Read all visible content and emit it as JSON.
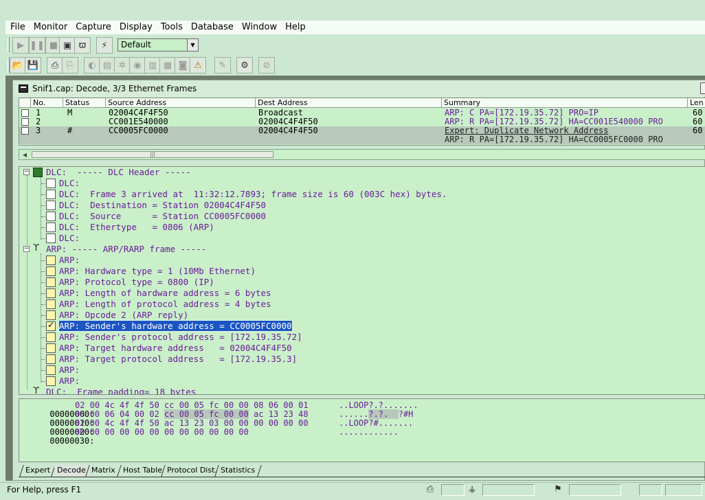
{
  "menu": [
    "File",
    "Monitor",
    "Capture",
    "Display",
    "Tools",
    "Database",
    "Window",
    "Help"
  ],
  "toolbar": {
    "profile_value": "Default",
    "row1_icons": [
      "play-icon",
      "pause-icon",
      "stop-icon",
      "stop-and-display-icon",
      "binoculars-icon",
      "define-filter-icon"
    ],
    "row2_icons": [
      "open-icon",
      "save-icon",
      "print-icon",
      "print-preview-icon",
      "dashboard-icon",
      "host-table-icon",
      "matrix-icon",
      "history-icon",
      "protocol-distribution-icon",
      "global-statistics-icon",
      "alarm-log-icon",
      "alarm-icon",
      "address-book-icon",
      "options-icon",
      "disable-icon"
    ]
  },
  "capture_window": {
    "title": "Snif1.cap: Decode, 3/3 Ethernet Frames"
  },
  "summary_table": {
    "columns": [
      "No.",
      "Status",
      "Source Address",
      "Dest Address",
      "Summary",
      "Len"
    ],
    "rows": [
      {
        "no": "1",
        "status": "M",
        "source": "02004C4F4F50",
        "dest": "Broadcast",
        "summary": "ARP: C PA=[172.19.35.72] PRO=IP",
        "len": "60"
      },
      {
        "no": "2",
        "status": "",
        "source": "CC001E540000",
        "dest": "02004C4F4F50",
        "summary": "ARP: R PA=[172.19.35.72] HA=CC001E540000 PRO",
        "len": "60"
      },
      {
        "no": "3",
        "status": "#",
        "source": "CC0005FC0000",
        "dest": "02004C4F4F50",
        "summary": "Expert: Duplicate Network Address",
        "summary2": "ARP: R PA=[172.19.35.72] HA=CC0005FC0000 PRO",
        "len": "60"
      }
    ]
  },
  "decode_tree": {
    "dlc_header": "DLC:  ----- DLC Header -----",
    "dlc_lines": [
      "DLC:",
      "DLC:  Frame 3 arrived at  11:32:12.7893; frame size is 60 (003C hex) bytes.",
      "DLC:  Destination = Station 02004C4F4F50",
      "DLC:  Source      = Station CC0005FC0000",
      "DLC:  Ethertype   = 0806 (ARP)",
      "DLC:"
    ],
    "arp_header": "ARP: ----- ARP/RARP frame -----",
    "arp_lines": [
      "ARP:",
      "ARP: Hardware type = 1 (10Mb Ethernet)",
      "ARP: Protocol type = 0800 (IP)",
      "ARP: Length of hardware address = 6 bytes",
      "ARP: Length of protocol address = 4 bytes",
      "ARP: Opcode 2 (ARP reply)",
      "ARP: Sender's hardware address = CC0005FC0000",
      "ARP: Sender's protocol address = [172.19.35.72]",
      "ARP: Target hardware address   = 02004C4F4F50",
      "ARP: Target protocol address   = [172.19.35.3]",
      "ARP:",
      "ARP:"
    ],
    "padding_line": "DLC:  Frame padding= 18 bytes"
  },
  "hex_dump": [
    {
      "addr": "00000000:",
      "bytes_a": "02 00 4c 4f 4f 50 cc 00 05 fc 00 00 08 06 00 01",
      "ascii": "..LOOP?.?......."
    },
    {
      "addr": "00000010:",
      "bytes_a": "08 00 06 04 00 02 ",
      "bytes_hl": "cc 00 05 fc 00 00",
      "bytes_b": " ac 13 23 48",
      "ascii_a": "......",
      "ascii_hl": "?.?.  ",
      "ascii_b": "?#H"
    },
    {
      "addr": "00000020:",
      "bytes_a": "02 00 4c 4f 4f 50 ac 13 23 03 00 00 00 00 00 00",
      "ascii": "..LOOP?#......."
    },
    {
      "addr": "00000030:",
      "bytes_a": "00 00 00 00 00 00 00 00 00 00 00 00",
      "ascii": "............"
    }
  ],
  "tabs": [
    "Expert",
    "Decode",
    "Matrix",
    "Host Table",
    "Protocol Dist.",
    "Statistics"
  ],
  "active_tab": "Decode",
  "statusbar": {
    "text": "For Help, press F1"
  }
}
